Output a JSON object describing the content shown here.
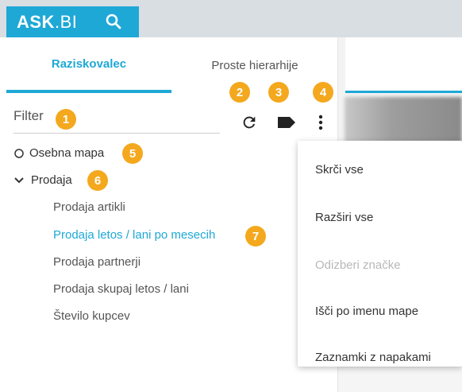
{
  "brand": {
    "logo_bold": "ASK",
    "logo_light": ".BI"
  },
  "tabs": [
    {
      "label": "Raziskovalec",
      "active": true
    },
    {
      "label": "Proste hierarhije",
      "active": false
    }
  ],
  "filter": {
    "label": "Filter"
  },
  "badges": [
    "1",
    "2",
    "3",
    "4",
    "5",
    "6",
    "7"
  ],
  "toolbar": {
    "refresh_icon": "refresh-icon",
    "tag_icon": "tag-icon",
    "more_icon": "more-vertical-icon"
  },
  "tree": {
    "personal": {
      "label": "Osebna mapa",
      "icon": "circle-outline-icon"
    },
    "sales": {
      "label": "Prodaja",
      "icon": "chevron-down-icon",
      "children": [
        {
          "label": "Prodaja artikli",
          "active": false
        },
        {
          "label": "Prodaja letos / lani po mesecih",
          "active": true
        },
        {
          "label": "Prodaja partnerji",
          "active": false
        },
        {
          "label": "Prodaja skupaj letos / lani",
          "active": false
        },
        {
          "label": "Število kupcev",
          "active": false
        }
      ]
    }
  },
  "menu": {
    "items": [
      {
        "label": "Skrči vse",
        "enabled": true
      },
      {
        "label": "Razširi vse",
        "enabled": true
      },
      {
        "label": "Odizberi značke",
        "enabled": false
      },
      {
        "label": "Išči po imenu mape",
        "enabled": true
      },
      {
        "label": "Zaznamki z napakami",
        "enabled": true
      }
    ]
  },
  "colors": {
    "accent": "#1ea8d6",
    "badge": "#f4a81d",
    "text": "#333333",
    "disabled": "#b8b8b8"
  }
}
